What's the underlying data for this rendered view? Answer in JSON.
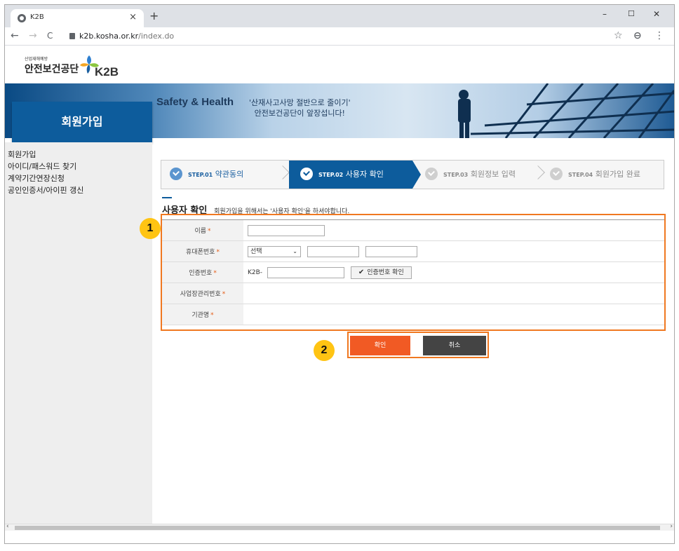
{
  "browser": {
    "tab_title": "K2B",
    "tab_close": "×",
    "new_tab": "+",
    "url_host": "k2b.kosha.or.kr",
    "url_path": "/index.do",
    "min": "–",
    "max": "☐",
    "close": "✕",
    "back": "←",
    "forward": "→",
    "reload": "C",
    "star": "☆",
    "account": "⊖",
    "menu": "⋮"
  },
  "header": {
    "logo_small": "산업재해예방",
    "logo_org": "안전보건공단",
    "logo_brand": "K2B"
  },
  "banner": {
    "title": "Safety & Health",
    "slogan_line1": "'산재사고사망 절반으로 줄이기'",
    "slogan_line2": "안전보건공단이 앞장섭니다!"
  },
  "page_title": "회원가입",
  "sidebar": {
    "items": [
      {
        "label": "회원가입"
      },
      {
        "label": "아이디/패스워드 찾기"
      },
      {
        "label": "계약기간연장신청"
      },
      {
        "label": "공인인증서/아이핀 갱신"
      }
    ]
  },
  "steps": [
    {
      "num": "STEP.01",
      "label": "약관동의",
      "state": "done"
    },
    {
      "num": "STEP.02",
      "label": "사용자 확인",
      "state": "active"
    },
    {
      "num": "STEP.03",
      "label": "회원정보 입력",
      "state": "inactive"
    },
    {
      "num": "STEP.04",
      "label": "회원가입 완료",
      "state": "inactive"
    }
  ],
  "section": {
    "title": "사용자 확인",
    "desc": "회원가입을 위해서는 '사용자 확인'을 하셔야합니다."
  },
  "form": {
    "required_mark": "*",
    "name_label": "이름",
    "phone_label": "휴대폰번호",
    "phone_select": "선택",
    "phone_select_arrow": "⌄",
    "auth_label": "인증번호",
    "auth_prefix": "K2B-",
    "auth_check": "✔",
    "auth_button": "인증번호 확인",
    "bizno_label": "사업장관리번호",
    "org_label": "기관명"
  },
  "badges": {
    "one": "1",
    "two": "2"
  },
  "actions": {
    "confirm": "확인",
    "cancel": "취소"
  },
  "scroll": {
    "left": "‹",
    "right": "›"
  },
  "colors": {
    "primary": "#0d5c9c",
    "accent": "#f15a24",
    "highlight": "#f07820",
    "badge": "#ffc413"
  }
}
